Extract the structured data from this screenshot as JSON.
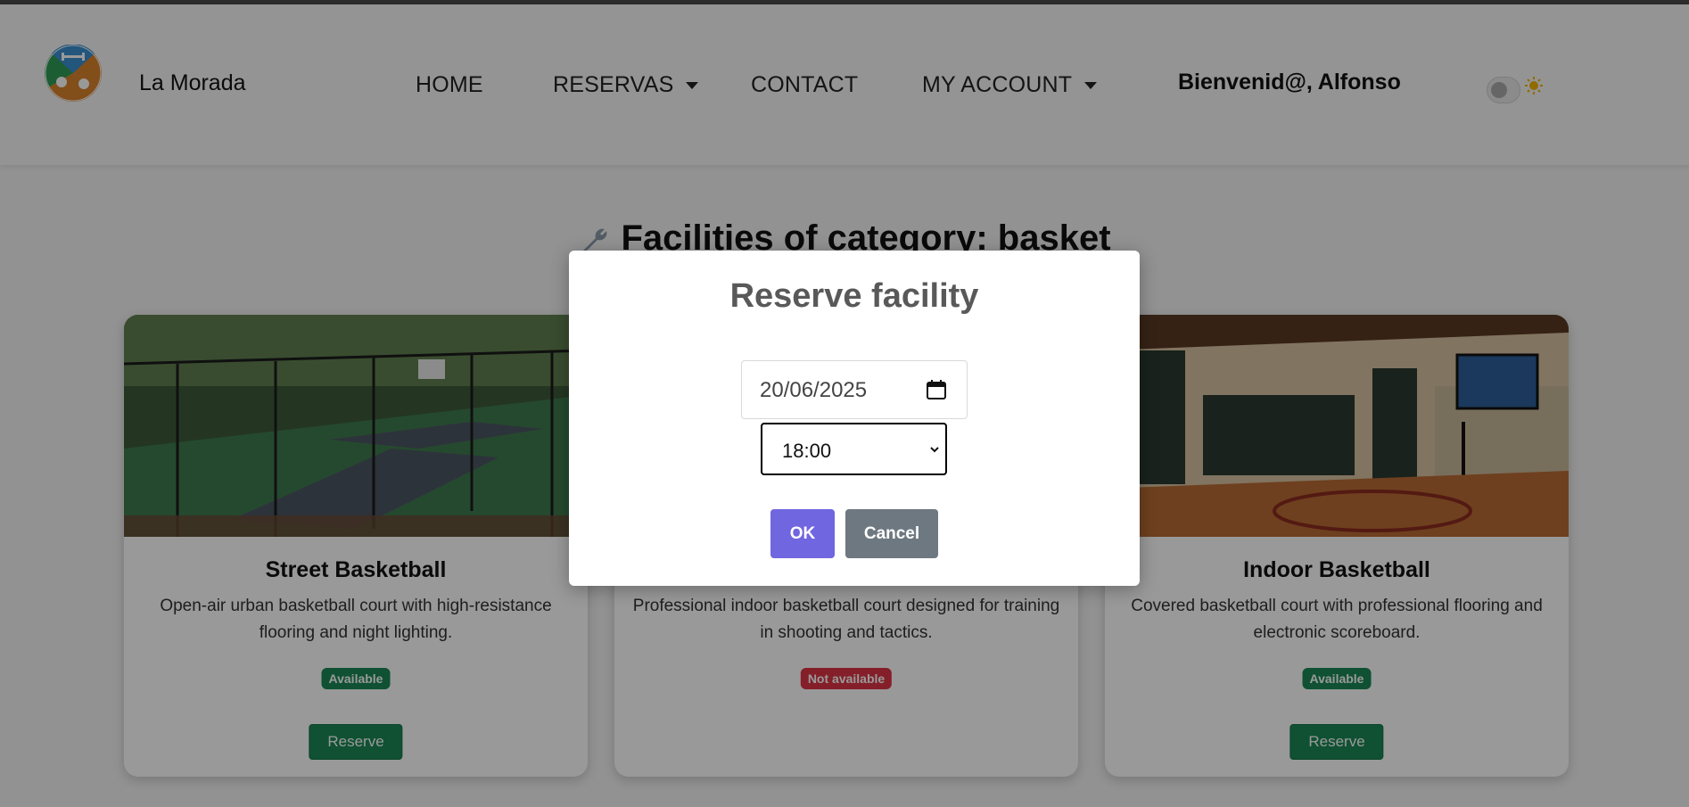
{
  "brand": {
    "name": "La Morada",
    "logo_icon": "sports-club-logo"
  },
  "nav": {
    "home": "HOME",
    "reservas": "RESERVAS",
    "contact": "CONTACT",
    "my_account": "MY ACCOUNT",
    "welcome": "Bienvenid@, Alfonso"
  },
  "theme_toggle": {
    "icon": "sun-icon",
    "state": "off"
  },
  "page": {
    "title": "Facilities of category: basket",
    "title_icon": "wrench-icon"
  },
  "facilities": [
    {
      "name": "Street Basketball",
      "description": "Open-air urban basketball court with high-resistance flooring and night lighting.",
      "status": "Available",
      "action": "Reserve"
    },
    {
      "name": "",
      "description": "Professional indoor basketball court designed for training in shooting and tactics.",
      "status": "Not available",
      "action": ""
    },
    {
      "name": "Indoor Basketball",
      "description": "Covered basketball court with professional flooring and electronic scoreboard.",
      "status": "Available",
      "action": "Reserve"
    }
  ],
  "modal": {
    "title": "Reserve facility",
    "date_value": "20/06/2025",
    "time_value": "18:00",
    "ok_label": "OK",
    "cancel_label": "Cancel"
  },
  "colors": {
    "ok_button": "#7066e0",
    "cancel_button": "#6e7881",
    "available_badge": "#198754",
    "unavailable_badge": "#dc3545",
    "reserve_button": "#198754"
  }
}
